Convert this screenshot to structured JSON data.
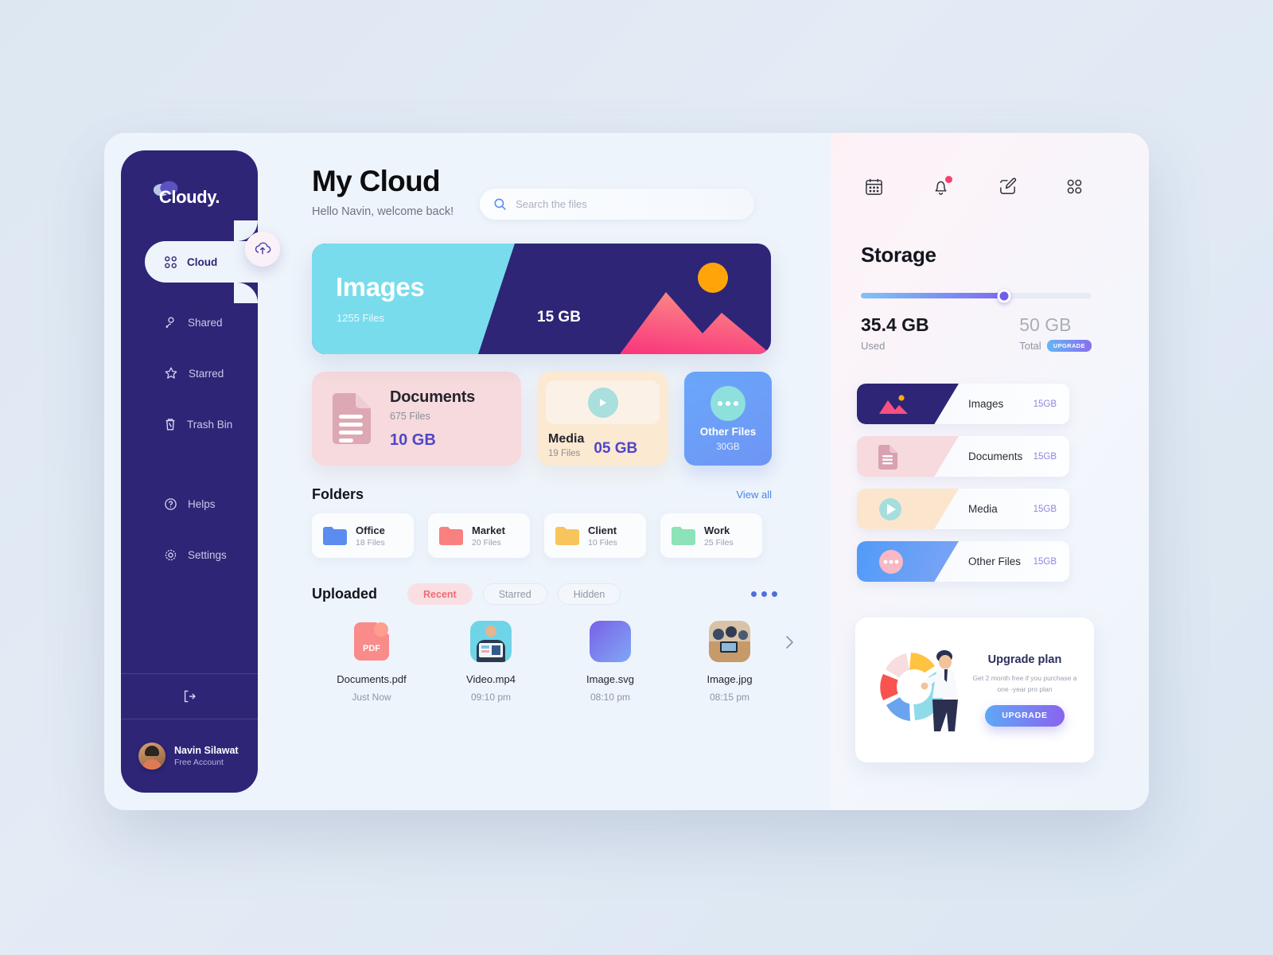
{
  "brand": {
    "name": "Cloudy."
  },
  "sidebar": {
    "active_item": {
      "label": "Cloud",
      "icon": "grid-icon"
    },
    "items": [
      {
        "label": "Shared",
        "icon": "shared-user-icon"
      },
      {
        "label": "Starred",
        "icon": "star-icon"
      },
      {
        "label": "Trash Bin",
        "icon": "trash-icon"
      },
      {
        "label": "Helps",
        "icon": "help-circle-icon"
      },
      {
        "label": "Settings",
        "icon": "gear-icon"
      }
    ],
    "logout_icon": "logout-icon",
    "upload_icon": "cloud-upload-icon",
    "profile": {
      "name": "Navin Silawat",
      "role": "Free Account"
    }
  },
  "header": {
    "title": "My Cloud",
    "subtitle": "Hello Navin, welcome back!",
    "search": {
      "placeholder": "Search the files",
      "value": "",
      "icon": "search-icon"
    }
  },
  "banner": {
    "title": "Images",
    "files": "1255 Files",
    "size": "15 GB",
    "cyan": "#79dced",
    "navy": "#2e2577"
  },
  "cards": {
    "documents": {
      "name": "Documents",
      "files": "675 Files",
      "size": "10 GB",
      "bg": "#f6dadd",
      "icon": "document-icon"
    },
    "media": {
      "name": "Media",
      "files": "19 Files",
      "size": "05 GB",
      "bg": "#fbe9d2",
      "icon": "play-icon"
    },
    "other": {
      "name": "Other Files",
      "size": "30GB",
      "bg": "#6aa8fb",
      "icon": "dots-icon"
    }
  },
  "folders_section": {
    "title": "Folders",
    "view_all": "View all",
    "folders": [
      {
        "name": "Office",
        "files": "18 Files",
        "color": "#5b8def"
      },
      {
        "name": "Market",
        "files": "20 Files",
        "color": "#f98080"
      },
      {
        "name": "Client",
        "files": "10 Files",
        "color": "#f8c45c"
      },
      {
        "name": "Work",
        "files": "25 Files",
        "color": "#8be3b7"
      }
    ]
  },
  "uploaded_section": {
    "title": "Uploaded",
    "tabs": [
      {
        "label": "Recent",
        "active": true
      },
      {
        "label": "Starred",
        "active": false
      },
      {
        "label": "Hidden",
        "active": false
      }
    ],
    "more_icon": "more-dots-icon",
    "next_icon": "chevron-right-icon",
    "files": [
      {
        "name": "Documents.pdf",
        "time": "Just Now",
        "type": "pdf"
      },
      {
        "name": "Video.mp4",
        "time": "09:10 pm",
        "type": "video"
      },
      {
        "name": "Image.svg",
        "time": "08:10 pm",
        "type": "svg"
      },
      {
        "name": "Image.jpg",
        "time": "08:15 pm",
        "type": "jpg"
      }
    ]
  },
  "right_panel": {
    "top_icons": [
      {
        "name": "calendar-icon"
      },
      {
        "name": "bell-icon",
        "has_dot": true
      },
      {
        "name": "edit-icon"
      },
      {
        "name": "apps-grid-icon"
      }
    ],
    "storage": {
      "title": "Storage",
      "used_value": "35.4 GB",
      "used_label": "Used",
      "total_value": "50 GB",
      "total_label": "Total",
      "upgrade_badge": "UPGRADE",
      "percent": 62,
      "rows": [
        {
          "name": "Images",
          "size": "15GB",
          "color": "#2e2577",
          "icon": "image-icon"
        },
        {
          "name": "Documents",
          "size": "15GB",
          "color": "#f6dadd",
          "icon": "document-icon"
        },
        {
          "name": "Media",
          "size": "15GB",
          "color": "#fbe6cd",
          "icon": "play-icon"
        },
        {
          "name": "Other Files",
          "size": "15GB",
          "color": "#5f9df8",
          "icon": "dots-icon"
        }
      ]
    },
    "upgrade": {
      "heading": "Upgrade plan",
      "description": "Get 2 month free if you purchase a one -year pro plan",
      "button": "UPGRADE"
    }
  }
}
